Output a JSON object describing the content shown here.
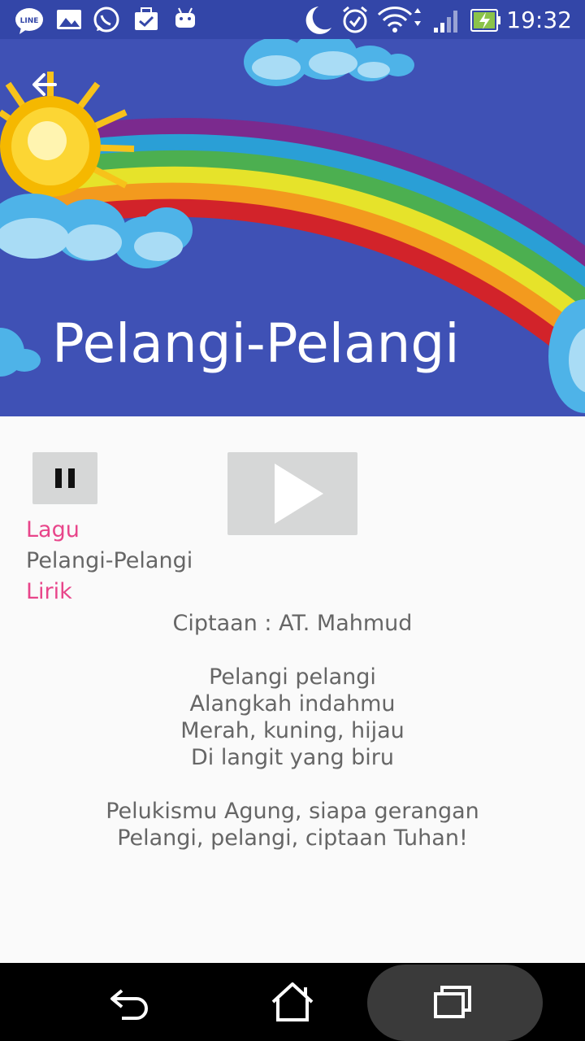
{
  "status_bar": {
    "time": "19:32",
    "icons": [
      "line-icon",
      "gallery-icon",
      "whatsapp-icon",
      "briefcase-icon",
      "android-icon",
      "night-mode-icon",
      "alarm-icon",
      "wifi-icon",
      "signal-icon",
      "battery-charging-icon"
    ]
  },
  "header": {
    "title": "Pelangi-Pelangi",
    "back_icon": "arrow-back-icon",
    "background_color": "#3f51b5"
  },
  "player": {
    "pause_icon": "pause-icon",
    "play_icon": "play-icon"
  },
  "song": {
    "label_song": "Lagu",
    "title": "Pelangi-Pelangi",
    "label_lyrics": "Lirik",
    "lyrics": [
      "Ciptaan : AT. Mahmud",
      "",
      "Pelangi pelangi",
      "Alangkah indahmu",
      "Merah, kuning, hijau",
      "Di langit yang biru",
      "",
      "Pelukismu Agung, siapa gerangan",
      "Pelangi, pelangi, ciptaan Tuhan!"
    ]
  },
  "nav_bar": {
    "icons": [
      "back-icon",
      "home-icon",
      "recents-icon"
    ]
  },
  "colors": {
    "accent_pink": "#e8458a",
    "text_gray": "#666666",
    "button_gray": "#d6d7d7"
  }
}
